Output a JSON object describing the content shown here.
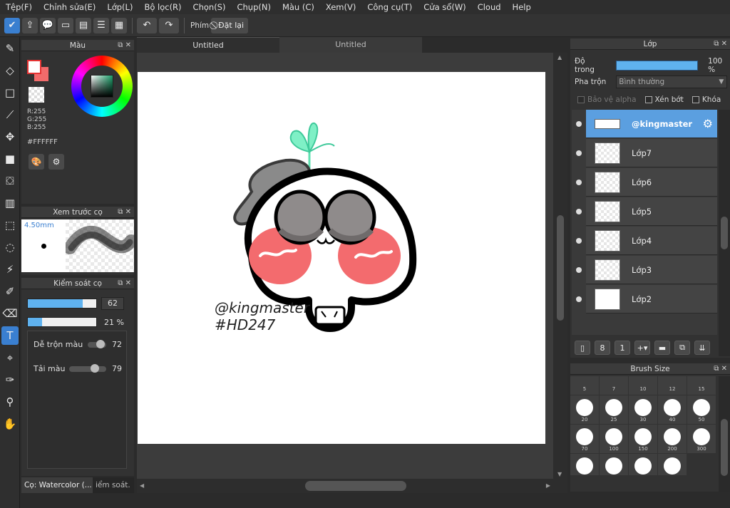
{
  "menu": [
    "Tệp(F)",
    "Chỉnh sửa(E)",
    "Lớp(L)",
    "Bộ lọc(R)",
    "Chọn(S)",
    "Chụp(N)",
    "Màu (C)",
    "Xem(V)",
    "Công cụ(T)",
    "Cửa sổ(W)",
    "Cloud",
    "Help"
  ],
  "toolbar": {
    "key_label": "Phím",
    "reset_label": "Đặt lại"
  },
  "color_panel": {
    "title": "Màu",
    "r": "R:255",
    "g": "G:255",
    "b": "B:255",
    "hex": "#FFFFFF",
    "front_color": "#ffffff",
    "back_color": "#f26b6b"
  },
  "preview_panel": {
    "title": "Xem trước cọ",
    "size": "4.50mm"
  },
  "control_panel": {
    "title": "Kiểm soát cọ",
    "size_value": "62",
    "opacity_value": "21 %",
    "size_fraction": 0.8,
    "opacity_fraction": 0.21,
    "blend_label": "Dễ trộn màu",
    "blend_value": "72",
    "paint_label": "Tải màu",
    "paint_value": "79"
  },
  "bottom_tabs": {
    "brush_tab": "Cọ: Watercolor (...",
    "control_tab": "iểm soát."
  },
  "doc_tabs": [
    "Untitled",
    "Untitled"
  ],
  "artwork": {
    "line1": "@kingmaster",
    "line2": "#HD247"
  },
  "layer_panel": {
    "title": "Lớp",
    "opacity_label": "Độ trong",
    "opacity_value": "100 %",
    "blend_label": "Pha trộn",
    "blend_value": "Bình thường",
    "protect_alpha": "Bảo vệ alpha",
    "clipping": "Xén bớt",
    "lock": "Khóa",
    "layers": [
      {
        "name": "@kingmaster",
        "selected": true
      },
      {
        "name": "Lớp7",
        "selected": false
      },
      {
        "name": "Lớp6",
        "selected": false
      },
      {
        "name": "Lớp5",
        "selected": false
      },
      {
        "name": "Lớp4",
        "selected": false
      },
      {
        "name": "Lớp3",
        "selected": false
      },
      {
        "name": "Lớp2",
        "selected": false
      }
    ]
  },
  "brush_size_panel": {
    "title": "Brush Size",
    "sizes": [
      "5",
      "7",
      "10",
      "12",
      "15",
      "20",
      "25",
      "30",
      "40",
      "50",
      "70",
      "100",
      "150",
      "200",
      "300"
    ]
  },
  "colors": {
    "accent": "#3a7fd0",
    "fill_blue": "#5fb2ef",
    "selected_layer": "#5b9fe0",
    "cheek_red": "#f36b6e",
    "sprout_green": "#5fe0b0"
  }
}
